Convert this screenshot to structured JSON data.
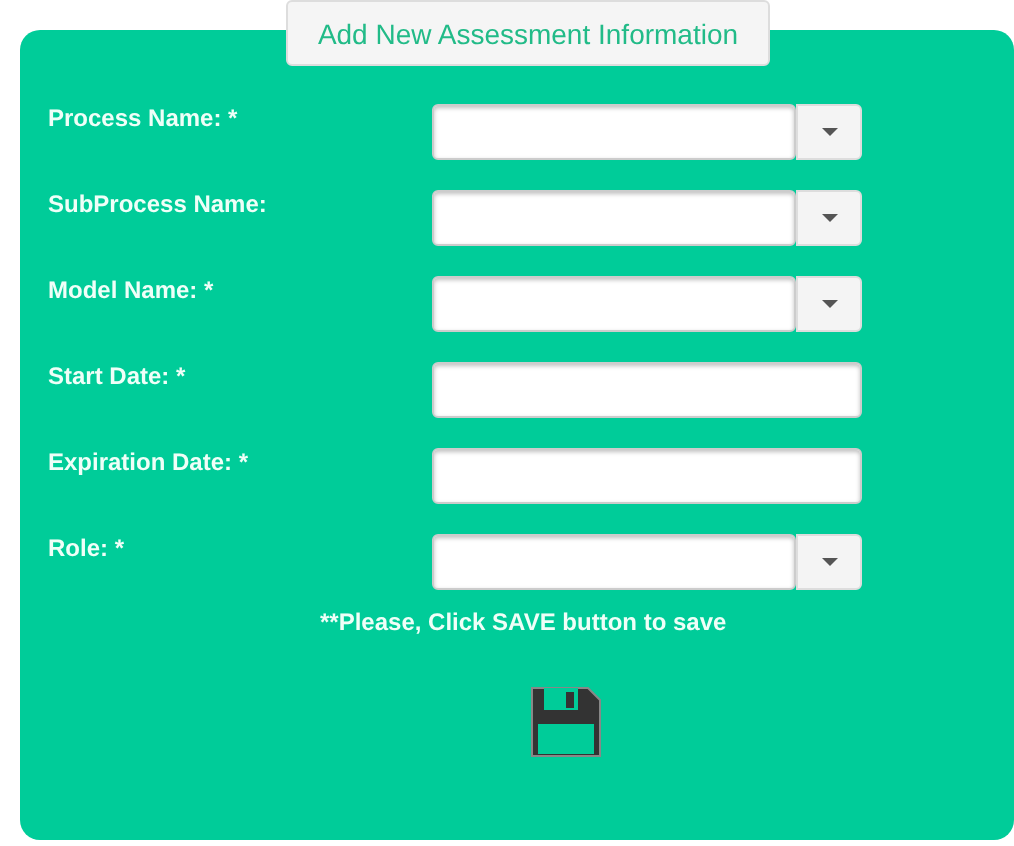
{
  "legend": "Add New Assessment Information",
  "fields": [
    {
      "label": "Process Name: *",
      "kind": "select"
    },
    {
      "label": "SubProcess Name:",
      "kind": "select"
    },
    {
      "label": "Model Name: *",
      "kind": "select"
    },
    {
      "label": "Start Date: *",
      "kind": "text"
    },
    {
      "label": "Expiration Date: *",
      "kind": "text"
    },
    {
      "label": "Role: *",
      "kind": "select"
    }
  ],
  "note": "**Please, Click SAVE button to save"
}
